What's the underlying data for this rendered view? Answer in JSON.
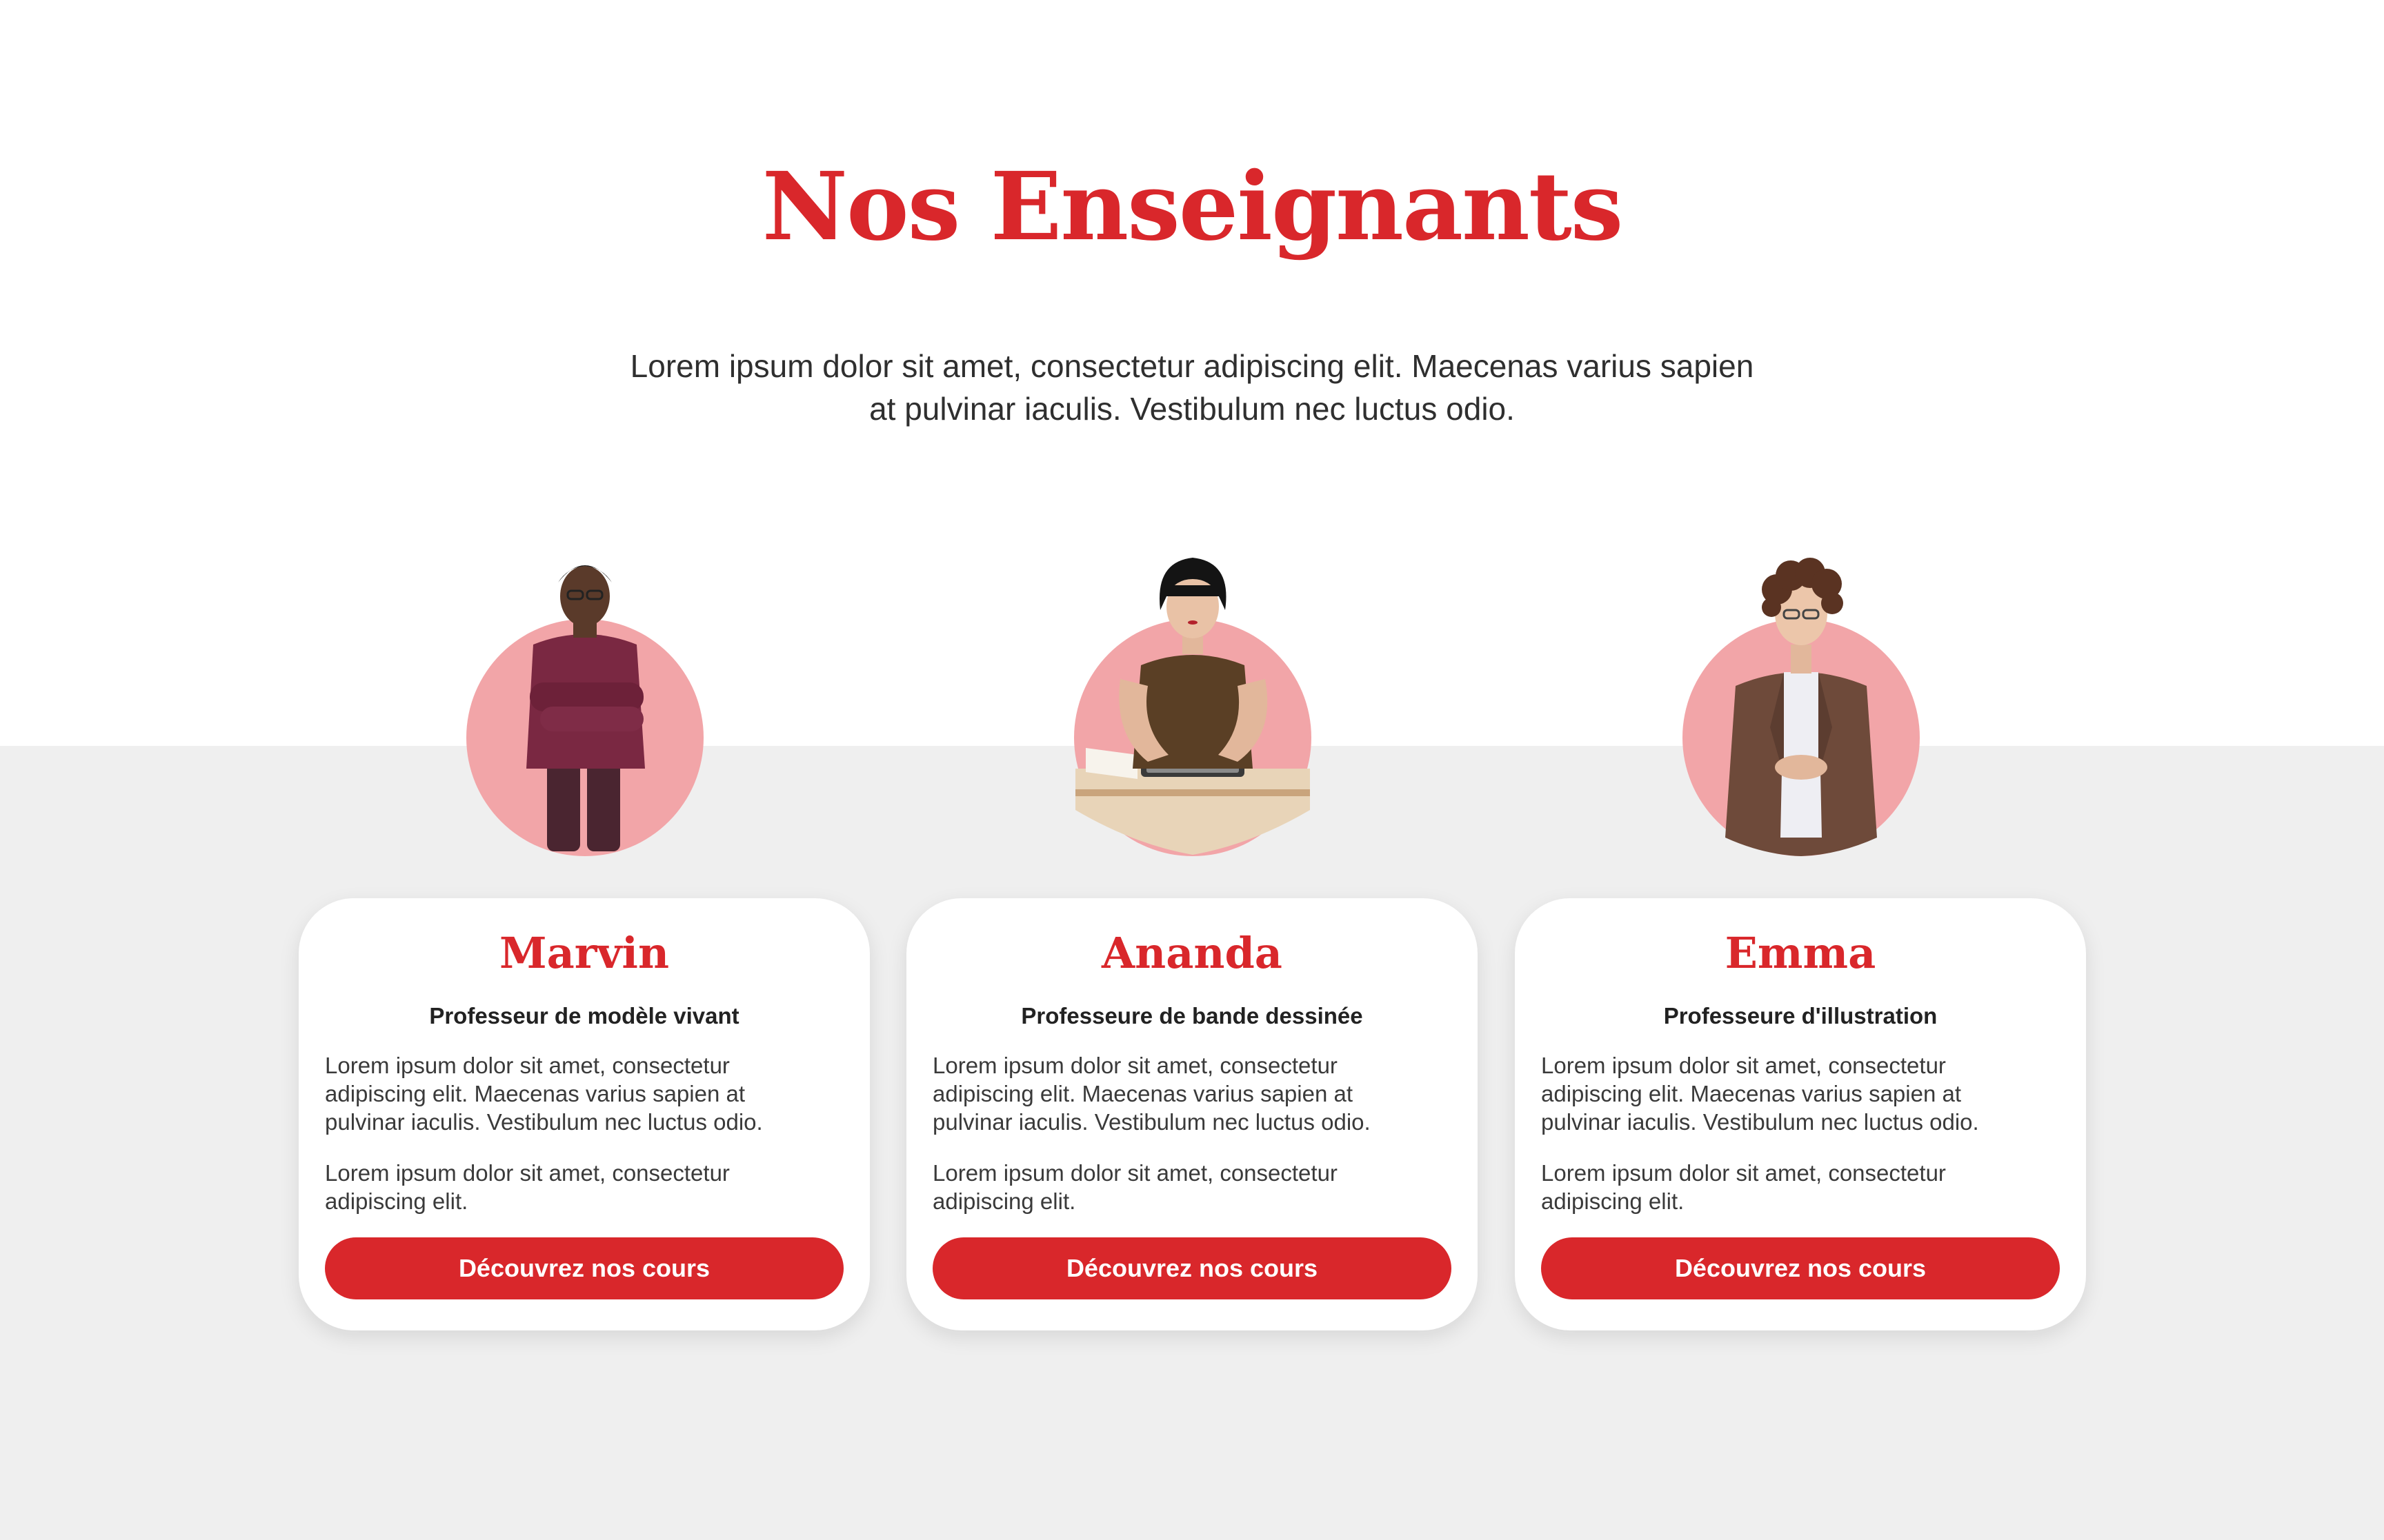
{
  "section": {
    "title": "Nos Enseignants",
    "intro": "Lorem ipsum dolor sit amet, consectetur adipiscing elit. Maecenas varius sapien at pulvinar iaculis. Vestibulum nec luctus odio."
  },
  "colors": {
    "accent": "#d9272b",
    "avatar_circle": "#f2a5a8",
    "band": "#efefef"
  },
  "teachers": [
    {
      "name": "Marvin",
      "role": "Professeur de modèle vivant",
      "text1": "Lorem ipsum dolor sit amet, consectetur adipiscing elit. Maecenas varius sapien at pulvinar iaculis. Vestibulum nec luctus odio.",
      "text2": "Lorem ipsum dolor sit amet, consectetur adipiscing elit.",
      "button": "Découvrez nos cours"
    },
    {
      "name": "Ananda",
      "role": "Professeure de bande dessinée",
      "text1": "Lorem ipsum dolor sit amet, consectetur adipiscing elit. Maecenas varius sapien at pulvinar iaculis. Vestibulum nec luctus odio.",
      "text2": "Lorem ipsum dolor sit amet, consectetur adipiscing elit.",
      "button": "Découvrez nos cours"
    },
    {
      "name": "Emma",
      "role": "Professeure d'illustration",
      "text1": "Lorem ipsum dolor sit amet, consectetur adipiscing elit. Maecenas varius sapien at pulvinar iaculis. Vestibulum nec luctus odio.",
      "text2": "Lorem ipsum dolor sit amet, consectetur adipiscing elit.",
      "button": "Découvrez nos cours"
    }
  ]
}
